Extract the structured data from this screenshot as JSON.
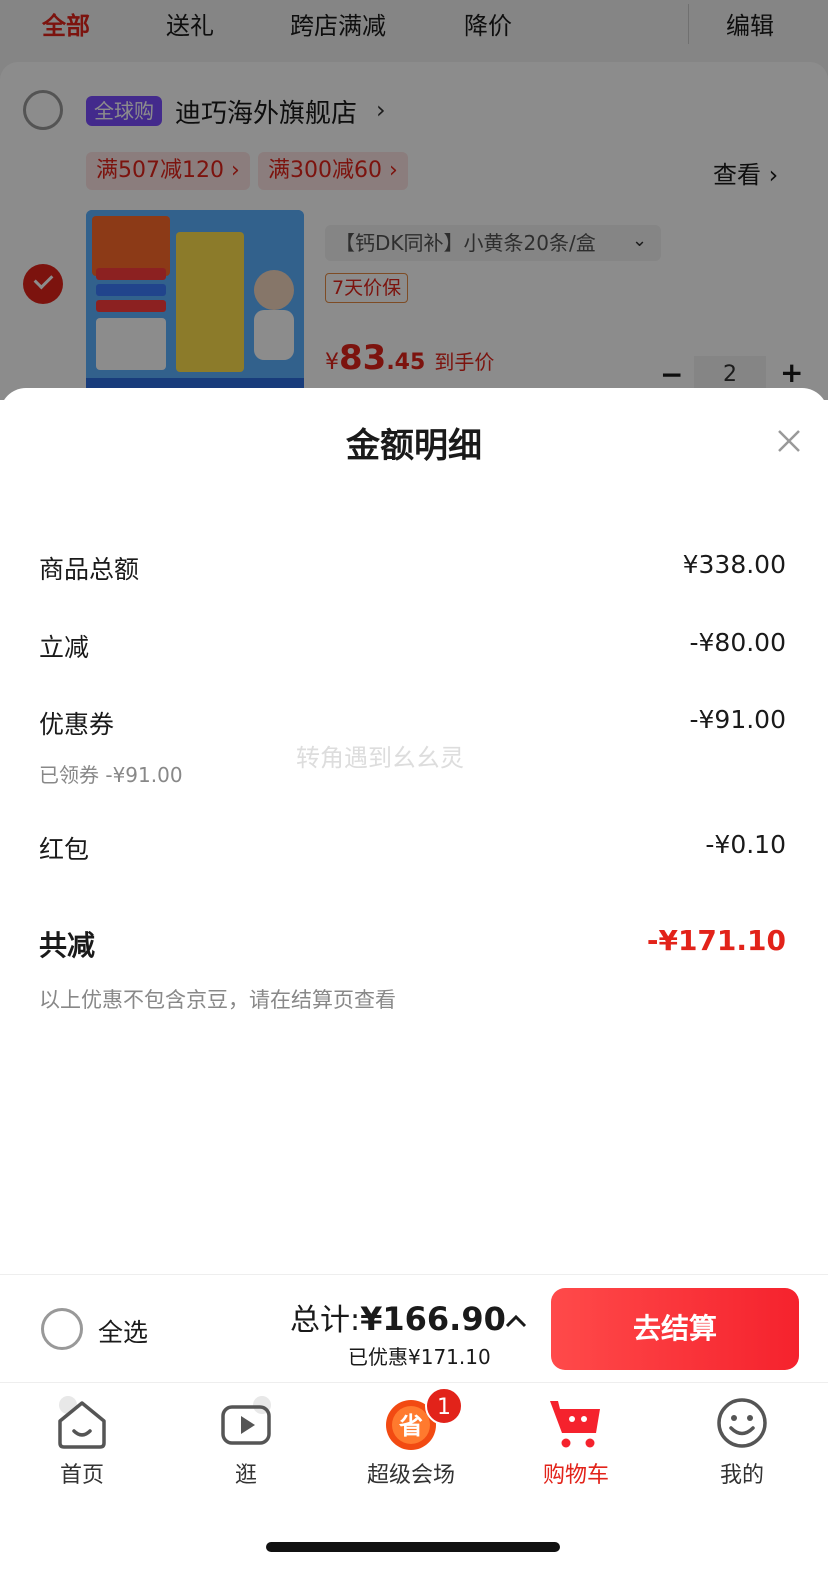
{
  "filter_tabs": [
    {
      "label": "全部"
    },
    {
      "label": "送礼"
    },
    {
      "label": "跨店满减"
    },
    {
      "label": "降价"
    }
  ],
  "filter_edit": "编辑",
  "store": {
    "badge": "全球购",
    "name": "迪巧海外旗舰店",
    "promos": [
      "满507减120 ›",
      "满300减60 ›"
    ],
    "view_link": "查看 ›"
  },
  "product": {
    "variant": "【钙DK同补】小黄条20条/盒",
    "guarantee": "7天价保",
    "price_symbol": "¥",
    "price_int": "83",
    "price_dec": ".45",
    "price_suffix": "到手价",
    "quantity": "2"
  },
  "sheet": {
    "title": "金额明细",
    "rows": [
      {
        "label": "商品总额",
        "value": "¥338.00"
      },
      {
        "label": "立减",
        "value": "-¥80.00"
      },
      {
        "label": "优惠券",
        "value": "-¥91.00",
        "note": "已领券 -¥91.00"
      },
      {
        "label": "红包",
        "value": "-¥0.10"
      }
    ],
    "total_label": "共减",
    "total_value": "-¥171.10",
    "footnote": "以上优惠不包含京豆，请在结算页查看",
    "watermark": "转角遇到幺幺灵"
  },
  "checkout": {
    "select_all": "全选",
    "total_prefix": "总计:",
    "total_amount": "¥166.90",
    "saved": "已优惠¥171.10",
    "button": "去结算"
  },
  "tabbar": [
    {
      "label": "首页",
      "icon": "home-icon"
    },
    {
      "label": "逛",
      "icon": "video-icon"
    },
    {
      "label": "超级会场",
      "icon": "super-venue-icon",
      "badge": "1"
    },
    {
      "label": "购物车",
      "icon": "cart-icon"
    },
    {
      "label": "我的",
      "icon": "profile-icon"
    }
  ],
  "colors": {
    "accent": "#e2231a",
    "badge_purple": "#7a4dff"
  }
}
